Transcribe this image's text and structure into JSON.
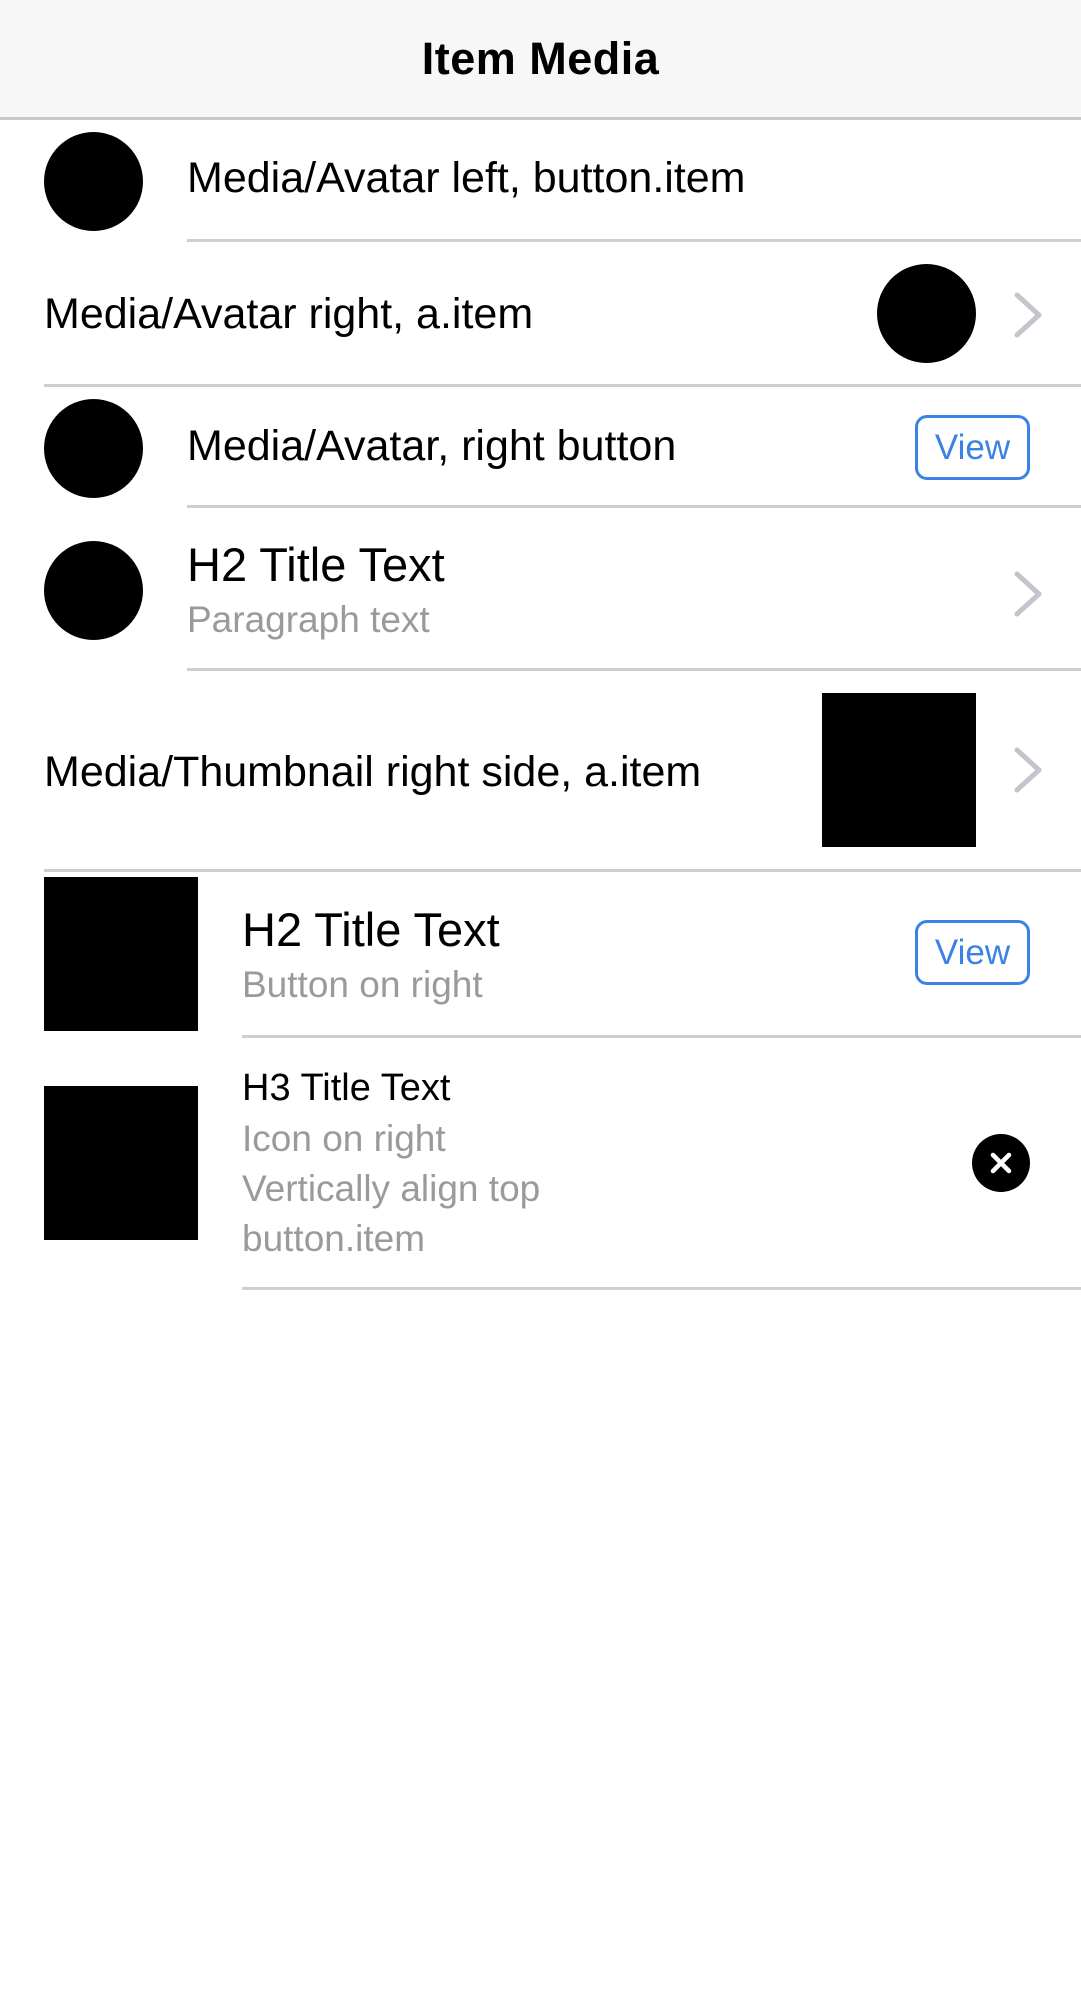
{
  "navbar": {
    "title": "Item Media"
  },
  "rows": [
    {
      "label": "Media/Avatar left, button.item"
    },
    {
      "label": "Media/Avatar right, a.item",
      "trailing_icon": "chevron-right-icon"
    },
    {
      "label": "Media/Avatar, right button",
      "button_label": "View"
    },
    {
      "title": "H2 Title Text",
      "subtitle": "Paragraph text",
      "trailing_icon": "chevron-right-icon"
    },
    {
      "label": "Media/Thumbnail right side, a.item",
      "trailing_icon": "chevron-right-icon"
    },
    {
      "title": "H2 Title Text",
      "subtitle": "Button on right",
      "button_label": "View"
    },
    {
      "title": "H3 Title Text",
      "lines": [
        "Icon on right",
        "Vertically align top",
        "button.item"
      ],
      "trailing_icon": "close-circle-icon"
    }
  ],
  "colors": {
    "accent": "#3b82e6",
    "separator": "#cfcfcf",
    "subtext": "#9a9a9a",
    "navbar_bg": "#f7f7f7"
  }
}
